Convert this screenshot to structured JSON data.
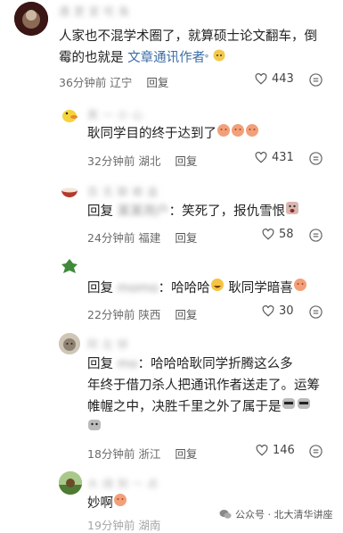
{
  "comments": [
    {
      "name": "遇 更 爱 吃 鱼",
      "text_parts": [
        "人家也不混学术圈了，就算硕士论文翻车，倒",
        "霉的也就是 "
      ],
      "link": "文章通讯作者",
      "time": "36分钟前",
      "location": "辽宁",
      "reply": "回复",
      "likes": "443"
    },
    {
      "name": "黑 一 小 心",
      "text": "耿同学目的终于达到了",
      "time": "32分钟前",
      "location": "湖北",
      "reply": "回复",
      "likes": "431"
    },
    {
      "name": "百 无 聊 赖 盒",
      "reply_prefix": "回复",
      "reply_target": "某某用户",
      "text": "：笑死了，报仇雪恨",
      "time": "24分钟前",
      "location": "福建",
      "reply": "回复",
      "likes": "58"
    },
    {
      "name": "",
      "reply_prefix": "回复",
      "reply_target": "momo",
      "text": "：哈哈哈",
      "text2": "耿同学暗喜",
      "time": "22分钟前",
      "location": "陕西",
      "reply": "回复",
      "likes": "30"
    },
    {
      "name": "阿 左 锌",
      "reply_prefix": "回复",
      "reply_target": "mo",
      "text_lines": [
        "：哈哈哈耿同学折腾这么多",
        "年终于借刀杀人把通讯作者送走了。运筹",
        "帷幄之中，决胜千里之外了属于是"
      ],
      "time": "18分钟前",
      "location": "浙江",
      "reply": "回复",
      "likes": "146"
    },
    {
      "name": "大 阔 到 一 点",
      "text": "妙啊",
      "time": "19分钟前",
      "location": "湖南"
    }
  ],
  "watermark": "公众号 · 北大清华讲座",
  "icons": {
    "like": "heart-outline-icon",
    "more": "more-circle-icon"
  }
}
